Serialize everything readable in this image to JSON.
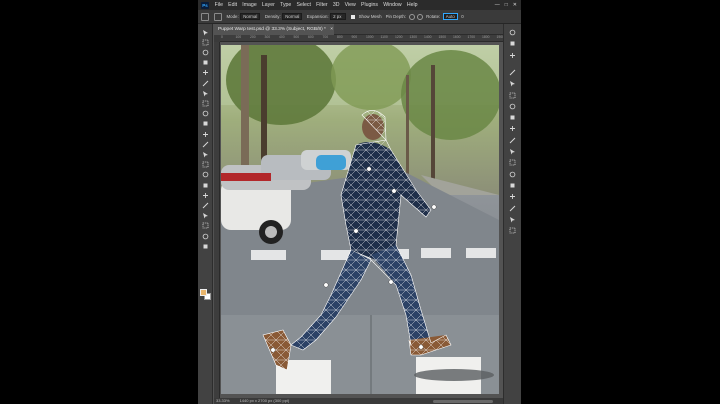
{
  "menubar": {
    "app_logo": "Ps",
    "items": [
      "File",
      "Edit",
      "Image",
      "Layer",
      "Type",
      "Select",
      "Filter",
      "3D",
      "View",
      "Plugins",
      "Window",
      "Help"
    ]
  },
  "options": {
    "mode_label": "Mode:",
    "mode_value": "Normal",
    "density_label": "Density:",
    "density_value": "Normal",
    "expansion_label": "Expansion:",
    "expansion_value": "2 px",
    "show_mesh_label": "Show Mesh",
    "pin_depth_label": "Pin Depth:",
    "rotate_label": "Rotate:",
    "rotate_value": "Auto",
    "rotate_degrees": "0"
  },
  "document": {
    "tab_title": "Puppet Warp test.psd @ 33.3% (Subject, RGB/8) *",
    "close_glyph": "×",
    "ruler_ticks": [
      "0",
      "100",
      "200",
      "300",
      "400",
      "500",
      "600",
      "700",
      "800",
      "900",
      "1000",
      "1100",
      "1200",
      "1300",
      "1400",
      "1500",
      "1600",
      "1700",
      "1800",
      "1900"
    ]
  },
  "statusbar": {
    "zoom": "33.33%",
    "dimensions": "1440 px x 2700 px (300 ppi)"
  },
  "colors": {
    "accent": "#31a8ff",
    "foreground_swatch": "#e9b56b",
    "background_swatch": "#ffffff"
  },
  "tools": [
    "move-icon",
    "marquee-icon",
    "lasso-icon",
    "object-select-icon",
    "crop-icon",
    "frame-icon",
    "eyedropper-icon",
    "healing-icon",
    "brush-icon",
    "clone-stamp-icon",
    "history-brush-icon",
    "eraser-icon",
    "gradient-icon",
    "blur-icon",
    "dodge-icon",
    "pen-icon",
    "type-icon",
    "path-select-icon",
    "rectangle-icon",
    "hand-icon",
    "zoom-icon",
    "more-tools-icon"
  ],
  "panels": [
    "history-icon",
    "play-icon",
    "stop-icon",
    "info-icon",
    "character-icon",
    "paragraph-icon",
    "adjust-icon",
    "3d-icon",
    "styles-icon",
    "swatches-icon",
    "gradients-icon",
    "patterns-icon",
    "color-icon",
    "properties-icon",
    "libraries-icon",
    "channels-icon",
    "paths-icon",
    "layers-icon"
  ]
}
